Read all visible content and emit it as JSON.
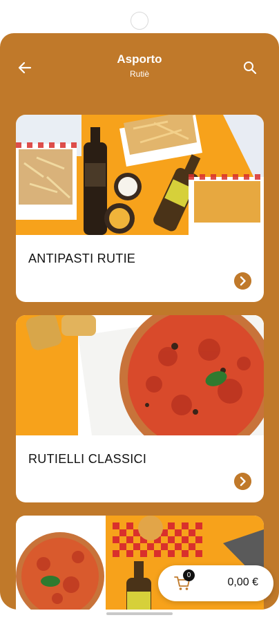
{
  "header": {
    "title": "Asporto",
    "subtitle": "Rutiè",
    "back_icon": "arrow-left-icon",
    "search_icon": "search-icon"
  },
  "categories": [
    {
      "label": "ANTIPASTI RUTIE",
      "image": "fries-and-beer-photo"
    },
    {
      "label": "RUTIELLI CLASSICI",
      "image": "pizza-in-box-photo"
    },
    {
      "label": "",
      "image": "pizza-and-beer-photo"
    }
  ],
  "cart": {
    "count": "0",
    "total": "0,00 €",
    "icon": "shopping-cart-icon"
  },
  "colors": {
    "brand": "#c0792a",
    "accent_orange": "#f7a21b",
    "checker_red": "#d9302c"
  }
}
